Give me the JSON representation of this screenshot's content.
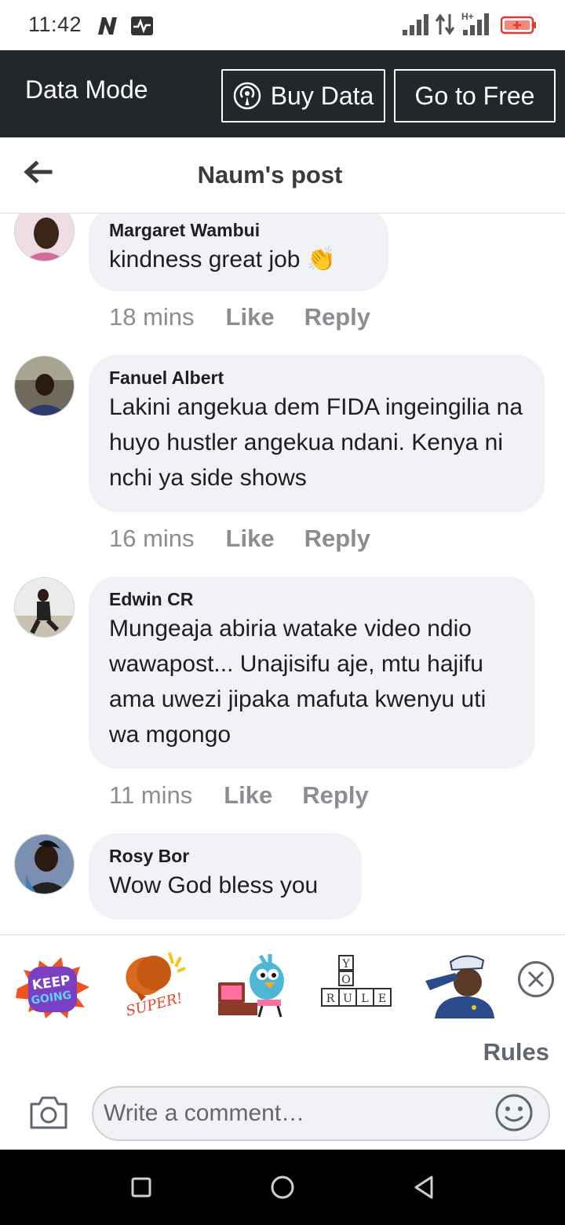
{
  "status_bar": {
    "time": "11:42",
    "icons": [
      "n-badge-icon",
      "pulse-icon",
      "signal-icon",
      "data-arrows-icon",
      "signal-hplus-icon",
      "battery-icon"
    ],
    "network_label": "H+"
  },
  "data_mode": {
    "title": "Data Mode",
    "buy_label": "Buy Data",
    "free_label": "Go to Free"
  },
  "header": {
    "title": "Naum's post"
  },
  "comments": [
    {
      "author": "Margaret Wambui",
      "text": "kindness great job 👏",
      "time": "18 mins",
      "like": "Like",
      "reply": "Reply"
    },
    {
      "author": "Fanuel Albert",
      "text": "Lakini angekua dem FIDA ingeingilia na huyo hustler angekua ndani. Kenya ni nchi ya side shows",
      "time": "16 mins",
      "like": "Like",
      "reply": "Reply"
    },
    {
      "author": "Edwin CR",
      "text": "Mungeaja abiria watake video ndio wawapost... Unajisifu aje, mtu hajifu ama uwezi jipaka mafuta kwenyu uti  wa mgongo",
      "time": "11 mins",
      "like": "Like",
      "reply": "Reply"
    },
    {
      "author": "Rosy Bor",
      "text": "Wow God bless you"
    }
  ],
  "stickers": {
    "items": [
      {
        "name": "keep-going-sticker",
        "text_line1": "KEEP",
        "text_line2": "GOING"
      },
      {
        "name": "super-sticker",
        "text": "SUPER!"
      },
      {
        "name": "bird-laptop-sticker"
      },
      {
        "name": "yo-rule-sticker",
        "tiles_top": [
          "Y",
          "O"
        ],
        "tiles_bottom": [
          "R",
          "U",
          "L",
          "E"
        ]
      },
      {
        "name": "salute-sticker"
      }
    ],
    "rules_label": "Rules"
  },
  "composer": {
    "placeholder": "Write a comment…"
  },
  "colors": {
    "data_bar": "#23272b",
    "bubble": "#f0f2f5",
    "meta_text": "#8a8d91",
    "nav_bar": "#000000"
  }
}
